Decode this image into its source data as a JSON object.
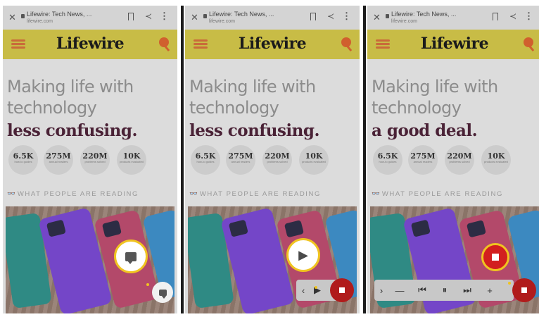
{
  "browser": {
    "tab_title": "Lifewire: Tech News, ...",
    "url": "lifewire.com",
    "close_glyph": "✕",
    "share_glyph": "≺",
    "more_glyph": "⋮"
  },
  "site": {
    "logo": "Lifewire",
    "hero_line1": "Making life with",
    "hero_line2": "technology",
    "stats": [
      {
        "value": "6.5K",
        "label": "how-to guides"
      },
      {
        "value": "275M",
        "label": "annual readers"
      },
      {
        "value": "220M",
        "label": "problems solved"
      },
      {
        "value": "10K",
        "label": "products evaluated"
      }
    ],
    "reading_label": "WHAT PEOPLE ARE READING",
    "glasses_glyph": "👓"
  },
  "panels": [
    {
      "tagline": "less confusing."
    },
    {
      "tagline": "less confusing."
    },
    {
      "tagline": "a good deal."
    }
  ],
  "controls": {
    "play_glyph": "▶",
    "minus_glyph": "—",
    "prev_glyph": "⏮",
    "pause_glyph": "⏸",
    "next_glyph": "⏭",
    "plus_glyph": "+",
    "collapse_glyph": "‹",
    "expand_glyph": "›"
  },
  "colors": {
    "header_bg": "#c8bc46",
    "tagline": "#4a2236",
    "stop_red": "#b01b1b",
    "highlight_ring": "#f0c420"
  }
}
